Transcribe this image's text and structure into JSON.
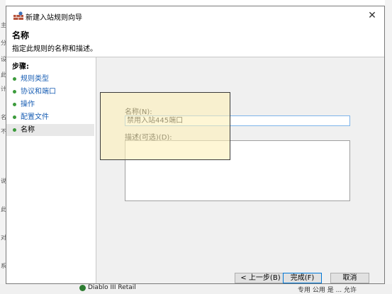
{
  "background": {
    "left_fragments": [
      "主",
      "分",
      "设",
      "此",
      "计",
      "名",
      "不",
      "说",
      "此",
      "对",
      "系"
    ],
    "bottom_app_label": "Diablo III Retail",
    "bottom_right_text": "专用  公用  是  ...  允许"
  },
  "window": {
    "title": "新建入站规则向导",
    "close_glyph": "✕"
  },
  "header": {
    "title": "名称",
    "description": "指定此规则的名称和描述。"
  },
  "steps": {
    "title": "步骤:",
    "items": [
      {
        "label": "规则类型"
      },
      {
        "label": "协议和端口"
      },
      {
        "label": "操作"
      },
      {
        "label": "配置文件"
      },
      {
        "label": "名称"
      }
    ]
  },
  "form": {
    "name_label": "名称(N):",
    "name_value": "禁用入站445端口",
    "desc_label": "描述(可选)(D):",
    "desc_value": ""
  },
  "buttons": {
    "back": "< 上一步(B)",
    "finish": "完成(F)",
    "cancel": "取消"
  },
  "colors": {
    "step_dot": "#3c9b3c",
    "step_link": "#1a5fb4",
    "highlight_fill": "#fdf0b9",
    "input_focus_border": "#7eb4ea"
  }
}
